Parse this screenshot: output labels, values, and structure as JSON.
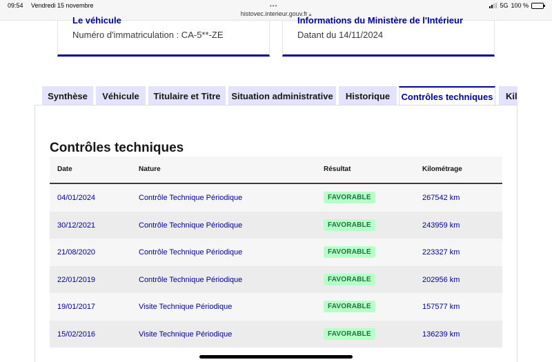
{
  "status_bar": {
    "time": "09:54",
    "date": "Vendredi 15 novembre",
    "url": "histovec.interieur.gouv.fr",
    "network": "5G",
    "battery": "100 %",
    "battery_level": 1.0
  },
  "cards": [
    {
      "title": "Le véhicule",
      "text": "Numéro d'immatriculation : CA-5**-ZE"
    },
    {
      "title": "Informations du Ministère de l'Intérieur",
      "text": "Datant du 14/11/2024"
    }
  ],
  "tabs": [
    {
      "label": "Synthèse"
    },
    {
      "label": "Véhicule"
    },
    {
      "label": "Titulaire et Titre"
    },
    {
      "label": "Situation administrative"
    },
    {
      "label": "Historique"
    },
    {
      "label": "Contrôles techniques"
    },
    {
      "label": "Kilométrage"
    }
  ],
  "active_tab": "Contrôles techniques",
  "section": {
    "title": "Contrôles techniques",
    "columns": [
      "Date",
      "Nature",
      "Résultat",
      "Kilométrage"
    ],
    "rows": [
      {
        "date": "04/01/2024",
        "nature": "Contrôle Technique Périodique",
        "resultat": "FAVORABLE",
        "km": "267542 km"
      },
      {
        "date": "30/12/2021",
        "nature": "Contrôle Technique Périodique",
        "resultat": "FAVORABLE",
        "km": "243959 km"
      },
      {
        "date": "21/08/2020",
        "nature": "Contrôle Technique Périodique",
        "resultat": "FAVORABLE",
        "km": "223327 km"
      },
      {
        "date": "22/01/2019",
        "nature": "Contrôle Technique Périodique",
        "resultat": "FAVORABLE",
        "km": "202956 km"
      },
      {
        "date": "19/01/2017",
        "nature": "Visite Technique Périodique",
        "resultat": "FAVORABLE",
        "km": "157577 km"
      },
      {
        "date": "15/02/2016",
        "nature": "Visite Technique Périodique",
        "resultat": "FAVORABLE",
        "km": "136239 km"
      }
    ]
  },
  "colors": {
    "primary": "#000091",
    "tab_bg": "#e3e3fd",
    "success_bg": "#b8fec9",
    "success_text": "#18753c"
  }
}
